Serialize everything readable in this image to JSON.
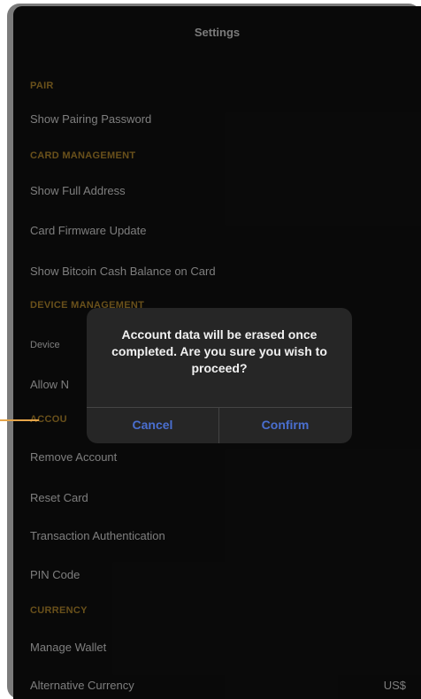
{
  "nav": {
    "title": "Settings"
  },
  "sections": {
    "pair": {
      "header": "PAIR",
      "items": [
        "Show Pairing Password"
      ]
    },
    "card_management": {
      "header": "CARD MANAGEMENT",
      "items": [
        "Show Full Address",
        "Card Firmware Update",
        "Show Bitcoin Cash Balance on Card"
      ]
    },
    "device_management": {
      "header": "DEVICE MANAGEMENT",
      "items": [
        "Device",
        "Allow N"
      ]
    },
    "account": {
      "header": "ACCOU",
      "items": [
        "Remove Account",
        "Reset Card",
        "Transaction Authentication",
        "PIN Code"
      ]
    },
    "currency": {
      "header": "CURRENCY",
      "items": [
        "Manage Wallet",
        "Alternative Currency"
      ],
      "alternative_value": "US$"
    }
  },
  "dialog": {
    "message": "Account data will be erased once completed. Are you sure you wish to proceed?",
    "cancel_label": "Cancel",
    "confirm_label": "Confirm"
  },
  "colors": {
    "background": "#111111",
    "section_header": "#b58a2e",
    "row_text": "#d8d8d8",
    "dialog_bg": "#262626",
    "dialog_button": "#4a6fd0",
    "pointer": "#e5a54a"
  }
}
